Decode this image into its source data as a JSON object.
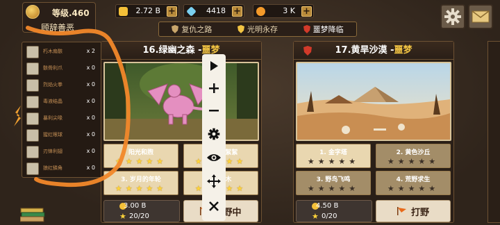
{
  "player": {
    "level": "等级.460",
    "title": "顾辞善恶"
  },
  "resources": [
    {
      "name": "gold",
      "value": "2.72 B",
      "color": "#f4c038"
    },
    {
      "name": "diamond",
      "value": "4418",
      "color": "#7ad0f0"
    },
    {
      "name": "orb",
      "value": "3 K",
      "color": "#f39a2a"
    }
  ],
  "modes": [
    {
      "label": "复仇之路",
      "color": "#c9a66b"
    },
    {
      "label": "光明永存",
      "color": "#f2c443"
    },
    {
      "label": "噩梦降临",
      "color": "#d23a2a"
    }
  ],
  "side_items": [
    {
      "label": "朽木扇骸",
      "count": "x 2"
    },
    {
      "label": "骸骨利爪",
      "count": "x 0"
    },
    {
      "label": "烈焰火拳",
      "count": "x 0"
    },
    {
      "label": "毒液结晶",
      "count": "x 0"
    },
    {
      "label": "暴利尖喙",
      "count": "x 0"
    },
    {
      "label": "猩红眼球",
      "count": "x 0"
    },
    {
      "label": "刃锋利翅",
      "count": "x 0"
    },
    {
      "label": "狼红鳞角",
      "count": "x 0"
    }
  ],
  "cards": [
    {
      "title": "16.绿幽之森 -",
      "tag": "噩梦",
      "subs": [
        {
          "label": "阳光和煦",
          "stars": "★★★★★"
        },
        {
          "label": "2. 树风絮絮",
          "stars": "★★★★★"
        },
        {
          "label": "3. 岁月的年轮",
          "stars": "★★★★★"
        },
        {
          "label": "4. 枯木",
          "stars": "★★★★★"
        }
      ],
      "cost": "3.00 B",
      "progress": "20/20",
      "button": "打野中"
    },
    {
      "title": "17.黄旱沙漠 -",
      "tag": "噩梦",
      "subs": [
        {
          "label": "1. 金字塔",
          "stars": "★★★★★"
        },
        {
          "label": "2. 黄色沙丘",
          "stars": "★★★★★"
        },
        {
          "label": "3. 野鸟飞鸣",
          "stars": "★★★★★"
        },
        {
          "label": "4. 荒野求生",
          "stars": "★★★★★"
        }
      ],
      "cost": "4.50 B",
      "progress": "0/20",
      "button": "打野"
    }
  ],
  "toolbar": [
    "play-icon",
    "zoom-in-icon",
    "zoom-out-icon",
    "settings-icon",
    "eye-icon",
    "move-icon",
    "close-icon"
  ]
}
